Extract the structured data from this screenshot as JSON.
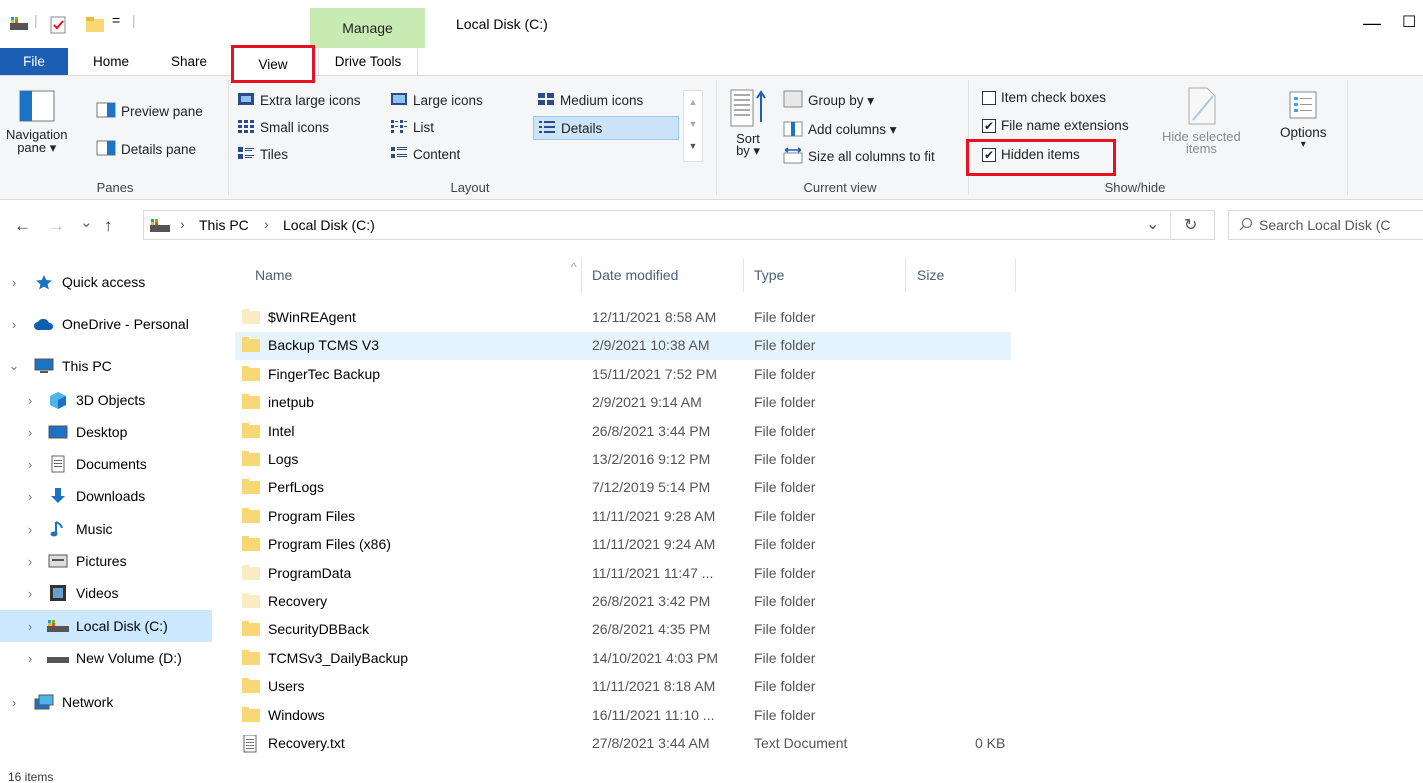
{
  "titlebar": {
    "manage_tab": "Manage",
    "window_title": "Local Disk (C:)",
    "quick_access_sep": "=",
    "minimize": "—",
    "maximize": "☐"
  },
  "ribbon_tabs": {
    "file": "File",
    "home": "Home",
    "share": "Share",
    "view": "View",
    "drive_tools": "Drive Tools"
  },
  "ribbon": {
    "panes": {
      "navigation_pane": "Navigation\npane ▾",
      "navigation_pane_l1": "Navigation",
      "navigation_pane_l2": "pane ▾",
      "preview_pane": "Preview pane",
      "details_pane": "Details pane",
      "label": "Panes"
    },
    "layout": {
      "extra_large_icons": "Extra large icons",
      "large_icons": "Large icons",
      "medium_icons": "Medium icons",
      "small_icons": "Small icons",
      "list": "List",
      "details": "Details",
      "tiles": "Tiles",
      "content": "Content",
      "label": "Layout",
      "selected": "Details"
    },
    "current_view": {
      "sort_by_l1": "Sort",
      "sort_by_l2": "by ▾",
      "group_by": "Group by ▾",
      "add_columns": "Add columns ▾",
      "size_all_columns": "Size all columns to fit",
      "label": "Current view"
    },
    "show_hide": {
      "item_check_boxes": "Item check boxes",
      "item_check_boxes_checked": false,
      "file_name_extensions": "File name extensions",
      "file_name_extensions_checked": true,
      "hidden_items": "Hidden items",
      "hidden_items_checked": true,
      "hide_selected_l1": "Hide selected",
      "hide_selected_l2": "items",
      "options": "Options",
      "options_arrow": "▾",
      "label": "Show/hide"
    }
  },
  "addressbar": {
    "back": "←",
    "forward": "→",
    "recent": "⌄",
    "up": "↑",
    "crumb_1": "This PC",
    "crumb_sep": "›",
    "crumb_2": "Local Disk (C:)",
    "dropdown": "⌄",
    "refresh": "↻",
    "search_placeholder": "Search Local Disk (C"
  },
  "navpane": {
    "items": [
      {
        "label": "Quick access",
        "icon": "star-icon"
      },
      {
        "label": "OneDrive - Personal",
        "icon": "cloud-icon"
      },
      {
        "label": "This PC",
        "icon": "computer-icon"
      },
      {
        "label": "3D Objects",
        "icon": "cube-icon"
      },
      {
        "label": "Desktop",
        "icon": "desktop-icon"
      },
      {
        "label": "Documents",
        "icon": "document-icon"
      },
      {
        "label": "Downloads",
        "icon": "download-icon"
      },
      {
        "label": "Music",
        "icon": "music-icon"
      },
      {
        "label": "Pictures",
        "icon": "pictures-icon"
      },
      {
        "label": "Videos",
        "icon": "video-icon"
      },
      {
        "label": "Local Disk (C:)",
        "icon": "drive-icon"
      },
      {
        "label": "New Volume (D:)",
        "icon": "drive-icon"
      },
      {
        "label": "Network",
        "icon": "network-icon"
      }
    ]
  },
  "filelist": {
    "columns": {
      "name": "Name",
      "date": "Date modified",
      "type": "Type",
      "size": "Size"
    },
    "sort_indicator": "^",
    "rows": [
      {
        "name": "$WinREAgent",
        "date": "12/11/2021 8:58 AM",
        "type": "File folder",
        "size": "",
        "hidden": true
      },
      {
        "name": "Backup TCMS V3",
        "date": "2/9/2021 10:38 AM",
        "type": "File folder",
        "size": "",
        "hidden": false
      },
      {
        "name": "FingerTec Backup",
        "date": "15/11/2021 7:52 PM",
        "type": "File folder",
        "size": "",
        "hidden": false
      },
      {
        "name": "inetpub",
        "date": "2/9/2021 9:14 AM",
        "type": "File folder",
        "size": "",
        "hidden": false
      },
      {
        "name": "Intel",
        "date": "26/8/2021 3:44 PM",
        "type": "File folder",
        "size": "",
        "hidden": false
      },
      {
        "name": "Logs",
        "date": "13/2/2016 9:12 PM",
        "type": "File folder",
        "size": "",
        "hidden": false
      },
      {
        "name": "PerfLogs",
        "date": "7/12/2019 5:14 PM",
        "type": "File folder",
        "size": "",
        "hidden": false
      },
      {
        "name": "Program Files",
        "date": "11/11/2021 9:28 AM",
        "type": "File folder",
        "size": "",
        "hidden": false
      },
      {
        "name": "Program Files (x86)",
        "date": "11/11/2021 9:24 AM",
        "type": "File folder",
        "size": "",
        "hidden": false
      },
      {
        "name": "ProgramData",
        "date": "11/11/2021 11:47 ...",
        "type": "File folder",
        "size": "",
        "hidden": true
      },
      {
        "name": "Recovery",
        "date": "26/8/2021 3:42 PM",
        "type": "File folder",
        "size": "",
        "hidden": true
      },
      {
        "name": "SecurityDBBack",
        "date": "26/8/2021 4:35 PM",
        "type": "File folder",
        "size": "",
        "hidden": false
      },
      {
        "name": "TCMSv3_DailyBackup",
        "date": "14/10/2021 4:03 PM",
        "type": "File folder",
        "size": "",
        "hidden": false
      },
      {
        "name": "Users",
        "date": "11/11/2021 8:18 AM",
        "type": "File folder",
        "size": "",
        "hidden": false
      },
      {
        "name": "Windows",
        "date": "16/11/2021 11:10 ...",
        "type": "File folder",
        "size": "",
        "hidden": false
      },
      {
        "name": "Recovery.txt",
        "date": "27/8/2021 3:44 AM",
        "type": "Text Document",
        "size": "0 KB",
        "hidden": false
      }
    ]
  },
  "statusbar": {
    "text": "16 items"
  },
  "colors": {
    "accent": "#1a5fb4",
    "highlight_red": "#e81123",
    "manage_green": "#c8ebb4",
    "selection": "#cce8ff",
    "folder": "#f8d775"
  }
}
